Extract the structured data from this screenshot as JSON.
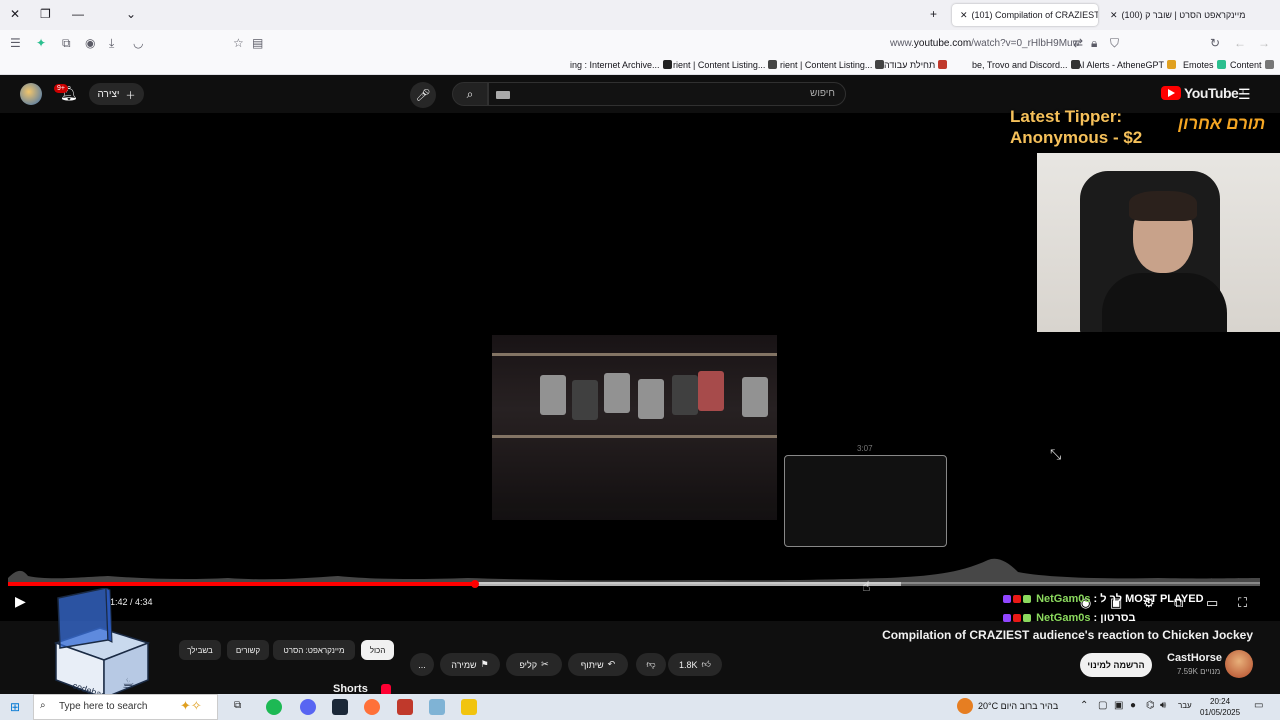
{
  "browser": {
    "tabs": [
      {
        "title": "(101) Compilation of CRAZIEST",
        "active": true
      },
      {
        "title": "(100) מיינקראפט הסרט | שובר ק",
        "active": false
      }
    ],
    "url_prefix": "www.",
    "url_domain": "youtube.com",
    "url_path": "/watch?v=0_rHlbH9Muw",
    "bookmarks": [
      {
        "label": "Content",
        "color": "#777777"
      },
      {
        "label": "Emotes",
        "color": "#2bbf8f"
      },
      {
        "label": "AI Alerts - AtheneGPT",
        "color": "#e0a020"
      },
      {
        "label": "be, Trovo and Discord...",
        "color": "#333333"
      },
      {
        "label": "תחילת עבודה",
        "color": "#c0392b"
      },
      {
        "label": "rient | Content Listing...",
        "color": "#444444"
      },
      {
        "label": "rient | Content Listing...",
        "color": "#444444"
      },
      {
        "label": "ing : Internet Archive...",
        "color": "#222222"
      }
    ]
  },
  "youtube": {
    "logo_text": "YouTube",
    "logo_region": "IL",
    "search_placeholder": "חיפוש",
    "create_label": "יצירה",
    "notification_count": "9+"
  },
  "stream_overlay": {
    "tipper_line1": "Latest Tipper:",
    "tipper_line2": "Anonymous - $2",
    "tipper_hebrew": "תורם אחרון"
  },
  "player": {
    "current_time": "1:42",
    "duration": "4:34",
    "time_display": "1:42 / 4:34",
    "played_fraction": 0.373,
    "buffered_fraction": 0.713,
    "preview_time": "3:07",
    "most_played_label": "MOST PLAYED"
  },
  "chat": [
    {
      "name": "NetGam0s",
      "message": ": לך ל"
    },
    {
      "name": "NetGam0s",
      "message": ": בסרטון"
    }
  ],
  "video": {
    "title": "Compilation of CRAZIEST audience's reaction to Chicken Jockey",
    "channel": "CastHorse",
    "subscribers": "7.59K מנויים",
    "subscribe_label": "הרשמה למינוי",
    "likes": "1.8K",
    "share_label": "שיתוף",
    "clip_label": "קליפ",
    "save_label": "שמירה",
    "more_label": "..."
  },
  "chips": [
    "הכול",
    "מיינקראפט: הסרט",
    "קשורים",
    "בשבילך"
  ],
  "shorts_label": "Shorts",
  "overlay_logo": "codebase",
  "taskbar": {
    "search_placeholder": "Type here to search",
    "weather": "20°C  בהיר ברוב היום",
    "lang": "עבר",
    "time": "20:24",
    "date": "01/05/2025"
  }
}
